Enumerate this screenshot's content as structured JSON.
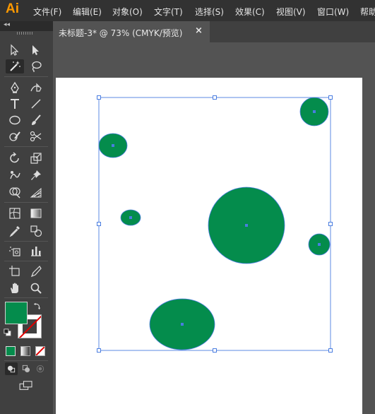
{
  "app": {
    "logo": "Ai"
  },
  "menu": [
    "文件(F)",
    "编辑(E)",
    "对象(O)",
    "文字(T)",
    "选择(S)",
    "效果(C)",
    "视图(V)",
    "窗口(W)",
    "帮助"
  ],
  "tab": {
    "label": "未标题-3* @ 73% (CMYK/预览)",
    "close": "×"
  },
  "toolbar": {
    "collapse": "◂◂",
    "tools": [
      "selection-tool",
      "direct-selection-tool",
      "magic-wand-tool",
      "lasso-tool",
      "pen-tool",
      "curvature-tool",
      "type-tool",
      "line-tool",
      "ellipse-tool",
      "paintbrush-tool",
      "shaper-tool",
      "scissors-tool",
      "rotate-tool",
      "scale-tool",
      "puppet-warp-tool",
      "free-transform-tool",
      "shape-builder-tool",
      "perspective-grid-tool",
      "mesh-tool",
      "gradient-tool",
      "eyedropper-tool",
      "blend-tool",
      "symbol-sprayer-tool",
      "column-graph-tool",
      "artboard-tool",
      "slice-tool",
      "hand-tool",
      "zoom-tool"
    ]
  },
  "colors": {
    "fill": "#048c4c",
    "stroke": "none",
    "accent": "#4a7de0",
    "app_orange": "#ff9a00"
  },
  "canvas": {
    "shape_color": "#048c4c",
    "selection_color": "#4a7de0"
  }
}
